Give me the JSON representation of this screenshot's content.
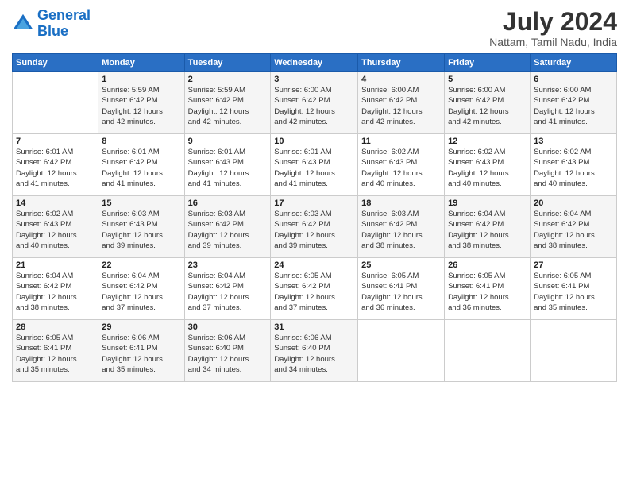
{
  "logo": {
    "line1": "General",
    "line2": "Blue"
  },
  "title": "July 2024",
  "location": "Nattam, Tamil Nadu, India",
  "header_days": [
    "Sunday",
    "Monday",
    "Tuesday",
    "Wednesday",
    "Thursday",
    "Friday",
    "Saturday"
  ],
  "weeks": [
    [
      {
        "day": "",
        "sunrise": "",
        "sunset": "",
        "daylight": ""
      },
      {
        "day": "1",
        "sunrise": "Sunrise: 5:59 AM",
        "sunset": "Sunset: 6:42 PM",
        "daylight": "Daylight: 12 hours and 42 minutes."
      },
      {
        "day": "2",
        "sunrise": "Sunrise: 5:59 AM",
        "sunset": "Sunset: 6:42 PM",
        "daylight": "Daylight: 12 hours and 42 minutes."
      },
      {
        "day": "3",
        "sunrise": "Sunrise: 6:00 AM",
        "sunset": "Sunset: 6:42 PM",
        "daylight": "Daylight: 12 hours and 42 minutes."
      },
      {
        "day": "4",
        "sunrise": "Sunrise: 6:00 AM",
        "sunset": "Sunset: 6:42 PM",
        "daylight": "Daylight: 12 hours and 42 minutes."
      },
      {
        "day": "5",
        "sunrise": "Sunrise: 6:00 AM",
        "sunset": "Sunset: 6:42 PM",
        "daylight": "Daylight: 12 hours and 42 minutes."
      },
      {
        "day": "6",
        "sunrise": "Sunrise: 6:00 AM",
        "sunset": "Sunset: 6:42 PM",
        "daylight": "Daylight: 12 hours and 41 minutes."
      }
    ],
    [
      {
        "day": "7",
        "sunrise": "Sunrise: 6:01 AM",
        "sunset": "Sunset: 6:42 PM",
        "daylight": "Daylight: 12 hours and 41 minutes."
      },
      {
        "day": "8",
        "sunrise": "Sunrise: 6:01 AM",
        "sunset": "Sunset: 6:42 PM",
        "daylight": "Daylight: 12 hours and 41 minutes."
      },
      {
        "day": "9",
        "sunrise": "Sunrise: 6:01 AM",
        "sunset": "Sunset: 6:43 PM",
        "daylight": "Daylight: 12 hours and 41 minutes."
      },
      {
        "day": "10",
        "sunrise": "Sunrise: 6:01 AM",
        "sunset": "Sunset: 6:43 PM",
        "daylight": "Daylight: 12 hours and 41 minutes."
      },
      {
        "day": "11",
        "sunrise": "Sunrise: 6:02 AM",
        "sunset": "Sunset: 6:43 PM",
        "daylight": "Daylight: 12 hours and 40 minutes."
      },
      {
        "day": "12",
        "sunrise": "Sunrise: 6:02 AM",
        "sunset": "Sunset: 6:43 PM",
        "daylight": "Daylight: 12 hours and 40 minutes."
      },
      {
        "day": "13",
        "sunrise": "Sunrise: 6:02 AM",
        "sunset": "Sunset: 6:43 PM",
        "daylight": "Daylight: 12 hours and 40 minutes."
      }
    ],
    [
      {
        "day": "14",
        "sunrise": "Sunrise: 6:02 AM",
        "sunset": "Sunset: 6:43 PM",
        "daylight": "Daylight: 12 hours and 40 minutes."
      },
      {
        "day": "15",
        "sunrise": "Sunrise: 6:03 AM",
        "sunset": "Sunset: 6:43 PM",
        "daylight": "Daylight: 12 hours and 39 minutes."
      },
      {
        "day": "16",
        "sunrise": "Sunrise: 6:03 AM",
        "sunset": "Sunset: 6:42 PM",
        "daylight": "Daylight: 12 hours and 39 minutes."
      },
      {
        "day": "17",
        "sunrise": "Sunrise: 6:03 AM",
        "sunset": "Sunset: 6:42 PM",
        "daylight": "Daylight: 12 hours and 39 minutes."
      },
      {
        "day": "18",
        "sunrise": "Sunrise: 6:03 AM",
        "sunset": "Sunset: 6:42 PM",
        "daylight": "Daylight: 12 hours and 38 minutes."
      },
      {
        "day": "19",
        "sunrise": "Sunrise: 6:04 AM",
        "sunset": "Sunset: 6:42 PM",
        "daylight": "Daylight: 12 hours and 38 minutes."
      },
      {
        "day": "20",
        "sunrise": "Sunrise: 6:04 AM",
        "sunset": "Sunset: 6:42 PM",
        "daylight": "Daylight: 12 hours and 38 minutes."
      }
    ],
    [
      {
        "day": "21",
        "sunrise": "Sunrise: 6:04 AM",
        "sunset": "Sunset: 6:42 PM",
        "daylight": "Daylight: 12 hours and 38 minutes."
      },
      {
        "day": "22",
        "sunrise": "Sunrise: 6:04 AM",
        "sunset": "Sunset: 6:42 PM",
        "daylight": "Daylight: 12 hours and 37 minutes."
      },
      {
        "day": "23",
        "sunrise": "Sunrise: 6:04 AM",
        "sunset": "Sunset: 6:42 PM",
        "daylight": "Daylight: 12 hours and 37 minutes."
      },
      {
        "day": "24",
        "sunrise": "Sunrise: 6:05 AM",
        "sunset": "Sunset: 6:42 PM",
        "daylight": "Daylight: 12 hours and 37 minutes."
      },
      {
        "day": "25",
        "sunrise": "Sunrise: 6:05 AM",
        "sunset": "Sunset: 6:41 PM",
        "daylight": "Daylight: 12 hours and 36 minutes."
      },
      {
        "day": "26",
        "sunrise": "Sunrise: 6:05 AM",
        "sunset": "Sunset: 6:41 PM",
        "daylight": "Daylight: 12 hours and 36 minutes."
      },
      {
        "day": "27",
        "sunrise": "Sunrise: 6:05 AM",
        "sunset": "Sunset: 6:41 PM",
        "daylight": "Daylight: 12 hours and 35 minutes."
      }
    ],
    [
      {
        "day": "28",
        "sunrise": "Sunrise: 6:05 AM",
        "sunset": "Sunset: 6:41 PM",
        "daylight": "Daylight: 12 hours and 35 minutes."
      },
      {
        "day": "29",
        "sunrise": "Sunrise: 6:06 AM",
        "sunset": "Sunset: 6:41 PM",
        "daylight": "Daylight: 12 hours and 35 minutes."
      },
      {
        "day": "30",
        "sunrise": "Sunrise: 6:06 AM",
        "sunset": "Sunset: 6:40 PM",
        "daylight": "Daylight: 12 hours and 34 minutes."
      },
      {
        "day": "31",
        "sunrise": "Sunrise: 6:06 AM",
        "sunset": "Sunset: 6:40 PM",
        "daylight": "Daylight: 12 hours and 34 minutes."
      },
      {
        "day": "",
        "sunrise": "",
        "sunset": "",
        "daylight": ""
      },
      {
        "day": "",
        "sunrise": "",
        "sunset": "",
        "daylight": ""
      },
      {
        "day": "",
        "sunrise": "",
        "sunset": "",
        "daylight": ""
      }
    ]
  ]
}
